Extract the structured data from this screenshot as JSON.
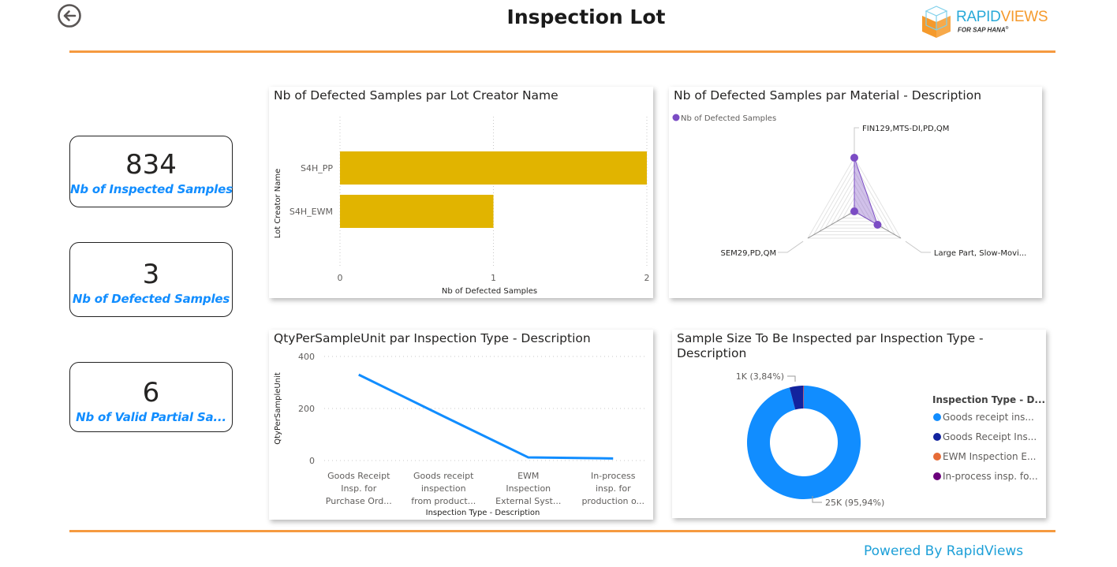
{
  "header": {
    "title": "Inspection Lot",
    "back_icon": "back-arrow-circle-icon",
    "logo": {
      "primary": "RAPID",
      "secondary": "VIEWS",
      "sub": "FOR SAP HANA",
      "mark": "®"
    }
  },
  "kpis": [
    {
      "value": "834",
      "label": "Nb of Inspected Samples"
    },
    {
      "value": "3",
      "label": "Nb of Defected Samples"
    },
    {
      "value": "6",
      "label": "Nb of Valid Partial Sa..."
    }
  ],
  "footer": {
    "text": "Powered By RapidViews"
  },
  "colors": {
    "accent": "#f59a40",
    "kpi_label": "#118dff",
    "bar": "#e1b400",
    "line": "#118dff",
    "radar": "#7b4cc4"
  },
  "chart_data": [
    {
      "type": "bar",
      "orientation": "horizontal",
      "title": "Nb of Defected Samples par Lot Creator Name",
      "categories": [
        "S4H_PP",
        "S4H_EWM"
      ],
      "values": [
        2,
        1
      ],
      "xlabel": "Nb of Defected Samples",
      "ylabel": "Lot Creator Name",
      "xlim": [
        0,
        2
      ],
      "xticks": [
        "0",
        "1",
        "2"
      ],
      "grid": true
    },
    {
      "type": "radar",
      "title": "Nb of Defected Samples par Material - Description",
      "legend": [
        "Nb of Defected Samples"
      ],
      "legend_position": "top-left",
      "categories": [
        "FIN129,MTS-DI,PD,QM",
        "Large Part, Slow-Movi...",
        "SEM29,PD,QM"
      ],
      "values": [
        2,
        1,
        0
      ],
      "rmax": 2
    },
    {
      "type": "line",
      "title": "QtyPerSampleUnit par Inspection Type - Description",
      "categories": [
        [
          "Goods Receipt",
          "Insp. for",
          "Purchase Ord..."
        ],
        [
          "Goods receipt",
          "inspection",
          "from product..."
        ],
        [
          "EWM",
          "Inspection",
          "External Syst..."
        ],
        [
          "In-process",
          "insp. for",
          "production o..."
        ]
      ],
      "values": [
        330,
        170,
        12,
        8
      ],
      "xlabel": "Inspection Type - Description",
      "ylabel": "QtyPerSampleUnit",
      "ylim": [
        0,
        400
      ],
      "yticks": [
        "0",
        "200",
        "400"
      ],
      "grid": true
    },
    {
      "type": "pie",
      "donut": true,
      "title": "Sample Size To Be Inspected par Inspection Type - Description",
      "legend_title": "Inspection Type - D...",
      "legend_position": "right",
      "slices": [
        {
          "label": "Goods receipt ins...",
          "percent": 95.94,
          "color": "#118dff",
          "data_label": "25K (95,94%)"
        },
        {
          "label": "Goods Receipt Ins...",
          "percent": 3.84,
          "color": "#12239e",
          "data_label": "1K (3,84%)"
        },
        {
          "label": "EWM Inspection E...",
          "percent": 0.12,
          "color": "#e66c37",
          "data_label": ""
        },
        {
          "label": "In-process insp. fo...",
          "percent": 0.1,
          "color": "#6b007b",
          "data_label": ""
        }
      ]
    }
  ]
}
